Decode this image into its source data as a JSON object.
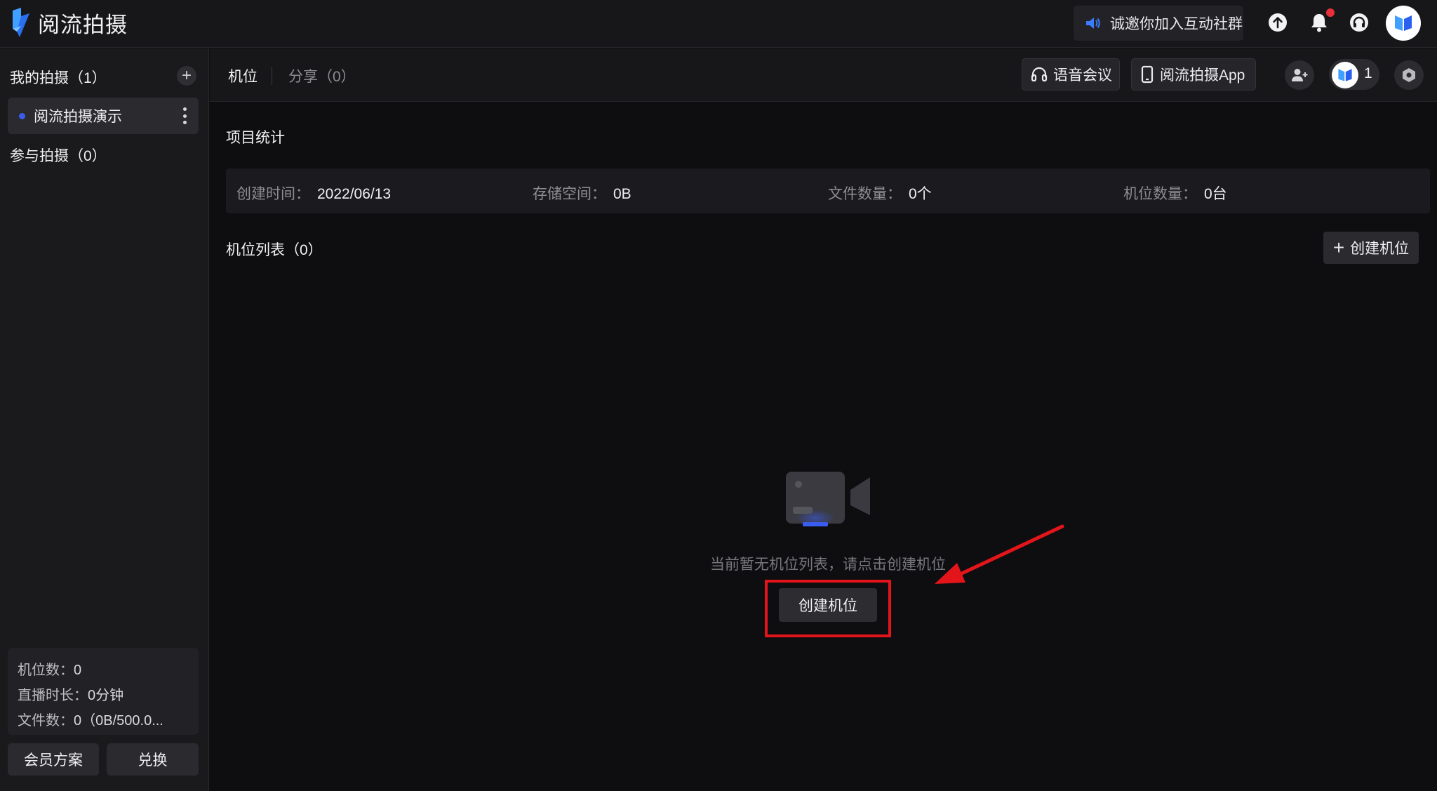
{
  "app": {
    "title": "阅流拍摄",
    "invite_text": "诚邀你加入互动社群"
  },
  "sidebar": {
    "my_shoots": "我的拍摄（1）",
    "add_symbol": "+",
    "project_name": "阅流拍摄演示",
    "joined_shoots": "参与拍摄（0）",
    "stats": {
      "camera_count_label": "机位数：",
      "camera_count_value": "0",
      "live_duration_label": "直播时长：",
      "live_duration_value": "0分钟",
      "file_count_label": "文件数：",
      "file_count_value": "0（0B/500.0..."
    },
    "membership_button": "会员方案",
    "redeem_button": "兑换"
  },
  "header": {
    "tab_active": "机位",
    "tab_share": "分享（0）",
    "voice_meeting": "语音会议",
    "app_button": "阅流拍摄App",
    "member_count": "1"
  },
  "main": {
    "project_stats_title": "项目统计",
    "stats": [
      {
        "label": "创建时间：",
        "value": "2022/06/13"
      },
      {
        "label": "存储空间：",
        "value": "0B"
      },
      {
        "label": "文件数量：",
        "value": "0个"
      },
      {
        "label": "机位数量：",
        "value": "0台"
      }
    ],
    "camera_list_title": "机位列表（0）",
    "create_top_label": "创建机位",
    "create_top_plus": "+",
    "empty_text": "当前暂无机位列表，请点击创建机位",
    "create_main_label": "创建机位"
  },
  "colors": {
    "background": "#0e0e10",
    "accent_blue": "#3b5cf0",
    "highlight_red": "#e3151a",
    "notification_dot": "#e8303a"
  },
  "icons": [
    "logo-icon",
    "speaker-icon",
    "upload-icon",
    "bell-icon",
    "headset-icon",
    "plus-icon",
    "more-icon",
    "headphones-icon",
    "phone-icon",
    "add-user-icon",
    "settings-icon",
    "camera-icon"
  ]
}
